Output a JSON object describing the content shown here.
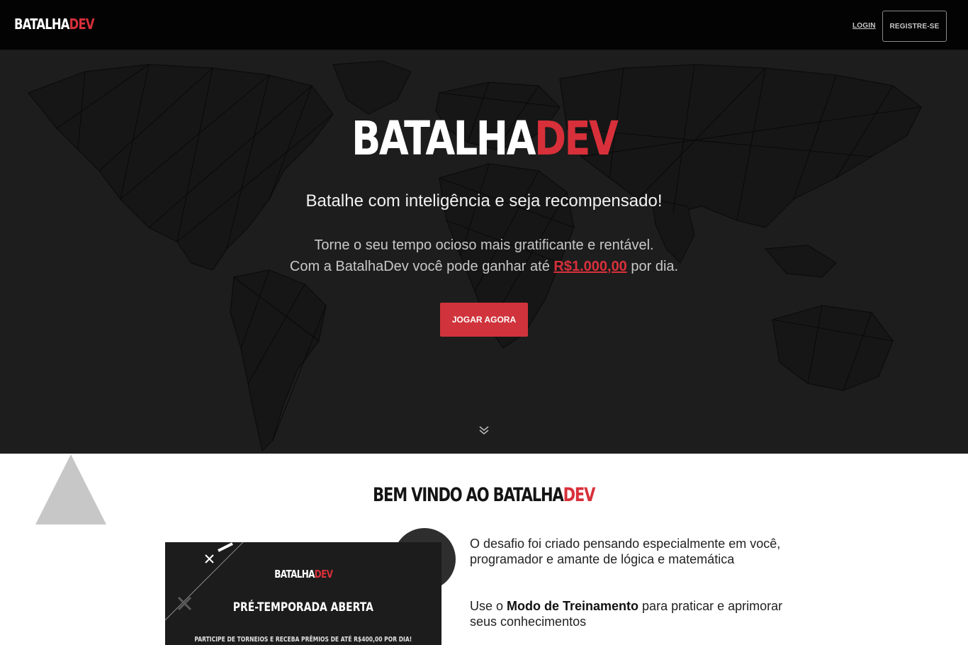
{
  "nav": {
    "logo": {
      "part1": "BATALHA",
      "part2": "DEV"
    },
    "login_label": "LOGIN",
    "register_label": "REGISTRE-SE"
  },
  "hero": {
    "logo": {
      "part1": "BATALHA",
      "part2": "DEV"
    },
    "headline": "Batalhe com inteligência e seja recompensado!",
    "sub_line1": "Torne o seu tempo ocioso mais gratificante e rentável.",
    "sub_line2_prefix": "Com a BatalhaDev você pode ganhar até ",
    "sub_amount": "R$1.000,00",
    "sub_line2_suffix": " por dia.",
    "cta_label": "JOGAR AGORA",
    "scroll_icon": "double-chevron-down-icon"
  },
  "welcome": {
    "title_part1": "BEM VINDO AO BATALHA",
    "title_part2": "DEV",
    "banner": {
      "logo_part1": "BATALHA",
      "logo_part2": "DEV",
      "title": "PRÉ-TEMPORADA ABERTA",
      "desc": "PARTICIPE DE TORNEIOS E RECEBA PRÊMIOS DE ATÉ R$400,00 POR DIA!"
    },
    "desc1": "O desafio foi criado pensando especialmente em você, programador e amante de lógica e matemática",
    "desc2_prefix": "Use o ",
    "desc2_bold": "Modo de Treinamento",
    "desc2_suffix": " para praticar e aprimorar seus conhecimentos"
  },
  "colors": {
    "accent": "#d8303a",
    "navbar_bg": "#030303",
    "hero_bg": "#1d1d1d"
  }
}
